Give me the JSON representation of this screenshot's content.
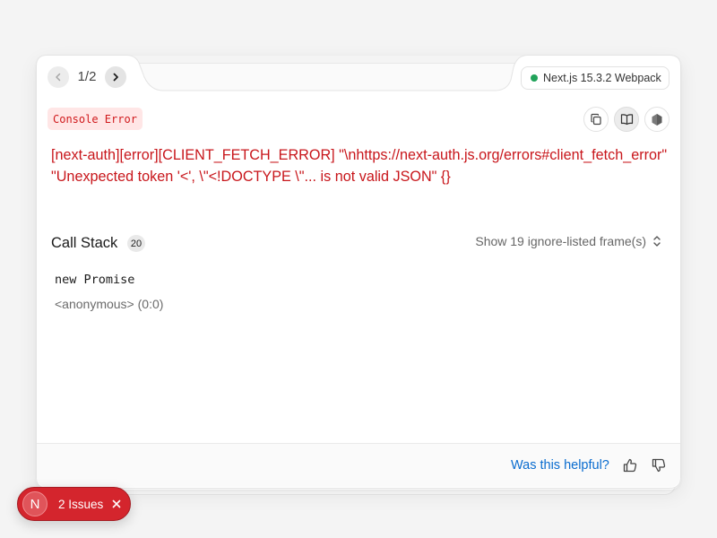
{
  "header": {
    "prev_icon": "chevron-left-icon",
    "next_icon": "chevron-right-icon",
    "counter": "1/2",
    "version_label": "Next.js 15.3.2 Webpack",
    "version_status_color": "#21a35a"
  },
  "error": {
    "badge": "Console Error",
    "message": "[next-auth][error][CLIENT_FETCH_ERROR] \"\\nhttps://next-auth.js.org/errors#client_fetch_error\" \"Unexpected token '<', \\\"<!DOCTYPE \\\"... is not valid JSON\" {}",
    "color": "#c8161b",
    "toolbar_icons": [
      "copy-icon",
      "docs-book-icon",
      "nodejs-hexagon-icon"
    ]
  },
  "call_stack": {
    "title": "Call Stack",
    "count": "20",
    "toggle_label": "Show 19 ignore-listed frame(s)",
    "toggle_icon": "chevron-up-down-icon",
    "frames": [
      {
        "name": "new Promise",
        "location": "<anonymous> (0:0)"
      }
    ]
  },
  "footer": {
    "helpful_label": "Was this helpful?",
    "link_color": "#0a6ccf",
    "vote_icons": [
      "thumbs-up-icon",
      "thumbs-down-icon"
    ]
  },
  "issues_badge": {
    "logo_letter": "N",
    "label": "2 Issues",
    "close_icon": "close-icon",
    "color": "#d4252d"
  }
}
